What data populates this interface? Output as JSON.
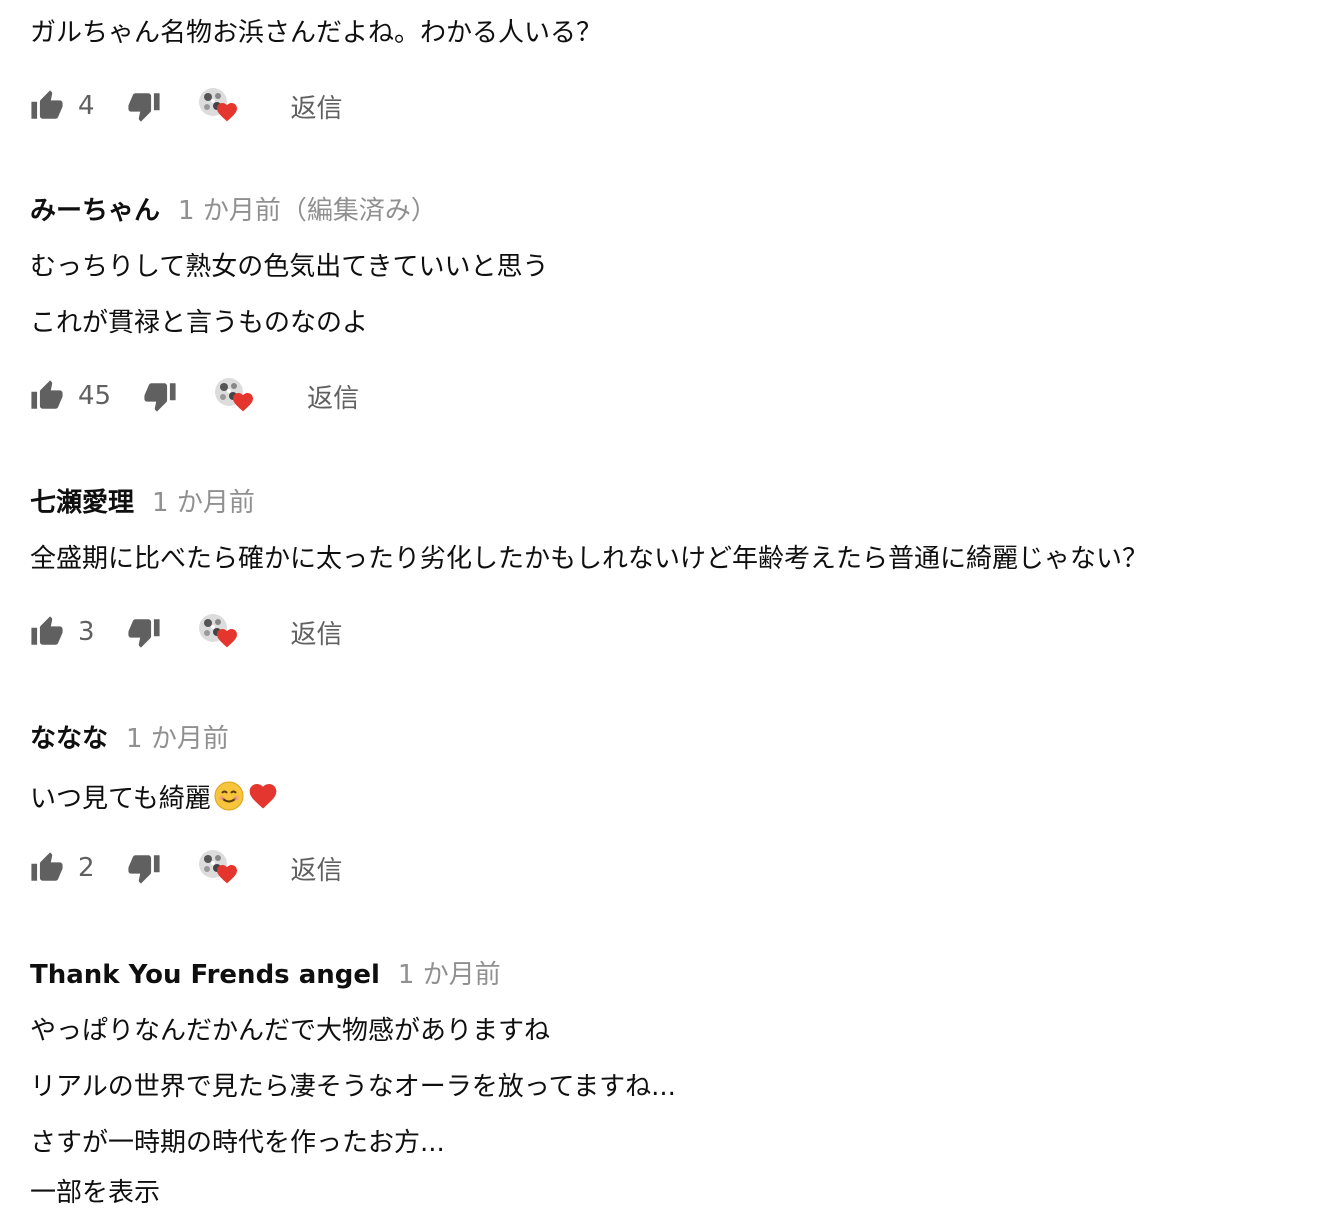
{
  "comments": [
    {
      "author": "",
      "time": "",
      "lines": [
        "ガルちゃん名物お浜さんだよね。わかる人いる？"
      ],
      "likes": "4",
      "reply_label": "返信"
    },
    {
      "author": "みーちゃん",
      "time": "1 か月前（編集済み）",
      "lines": [
        "むっちりして熟女の色気出てきていいと思う",
        "これが貫禄と言うものなのよ"
      ],
      "likes": "45",
      "reply_label": "返信"
    },
    {
      "author": "七瀬愛理",
      "time": "1 か月前",
      "lines": [
        "全盛期に比べたら確かに太ったり劣化したかもしれないけど年齢考えたら普通に綺麗じゃない？"
      ],
      "likes": "3",
      "reply_label": "返信"
    },
    {
      "author": "ななな",
      "time": "1 か月前",
      "lines": [
        "いつ見ても綺麗"
      ],
      "likes": "2",
      "reply_label": "返信"
    },
    {
      "author": "Thank You Frends angel",
      "time": "1 か月前",
      "lines": [
        "やっぱりなんだかんだで大物感がありますね",
        "リアルの世界で見たら凄そうなオーラを放ってますね...",
        "さすが一時期の時代を作ったお方..."
      ],
      "show_more_label": "一部を表示"
    }
  ],
  "icons": {
    "like": "thumbs-up-icon",
    "dislike": "thumbs-down-icon",
    "hearted": "creator-heart-icon",
    "emoji_smile": "smiling-face-emoji",
    "emoji_heart": "red-heart-emoji"
  },
  "colors": {
    "meta_gray": "#909090",
    "action_gray": "#606060",
    "heart_red": "#e4362e"
  }
}
